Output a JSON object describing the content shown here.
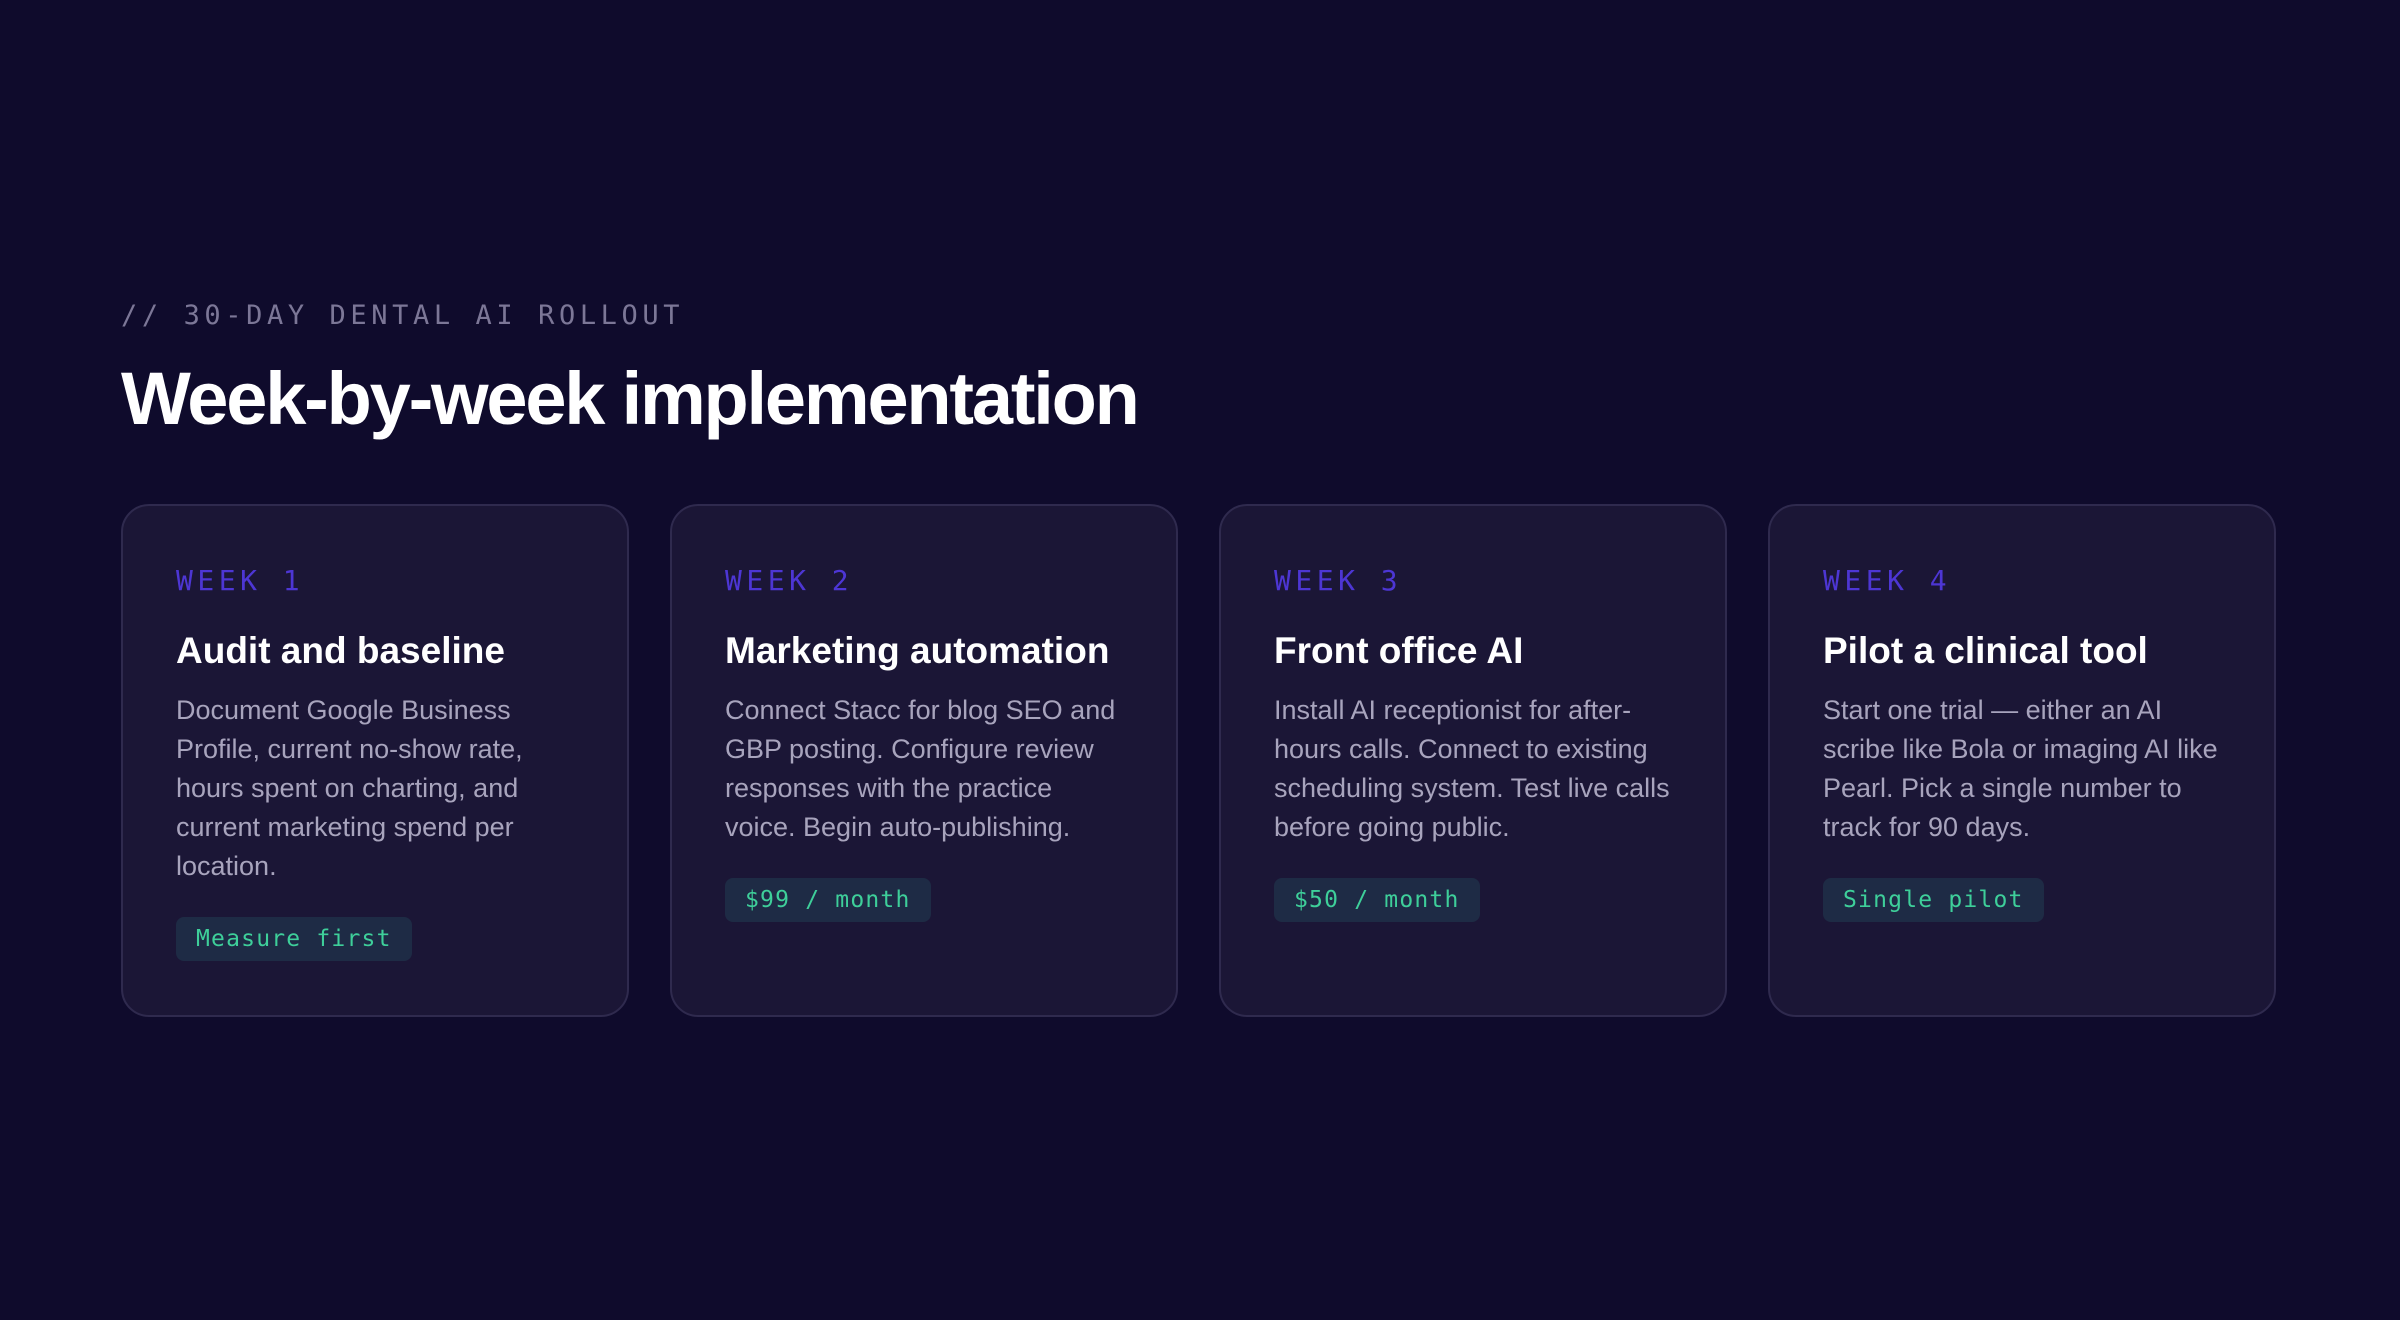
{
  "header": {
    "eyebrow": "// 30-DAY DENTAL AI ROLLOUT",
    "title": "Week-by-week implementation"
  },
  "cards": [
    {
      "week": "WEEK 1",
      "title": "Audit and baseline",
      "body": "Document Google Business Profile, current no-show rate, hours spent on charting, and current marketing spend per location.",
      "badge": "Measure first"
    },
    {
      "week": "WEEK 2",
      "title": "Marketing automation",
      "body": "Connect Stacc for blog SEO and GBP posting. Configure review responses with the practice voice. Begin auto-publishing.",
      "badge": "$99 / month"
    },
    {
      "week": "WEEK 3",
      "title": "Front office AI",
      "body": "Install AI receptionist for after-hours calls. Connect to existing scheduling system. Test live calls before going public.",
      "badge": "$50 / month"
    },
    {
      "week": "WEEK 4",
      "title": "Pilot a clinical tool",
      "body": "Start one trial — either an AI scribe like Bola or imaging AI like Pearl. Pick a single number to track for 90 days.",
      "badge": "Single pilot"
    }
  ],
  "colors": {
    "background": "#0f0b2c",
    "card": "#1b1636",
    "accent_week": "#4d36d4",
    "badge_text": "#3ecf9a",
    "badge_bg": "#1e2b45"
  }
}
